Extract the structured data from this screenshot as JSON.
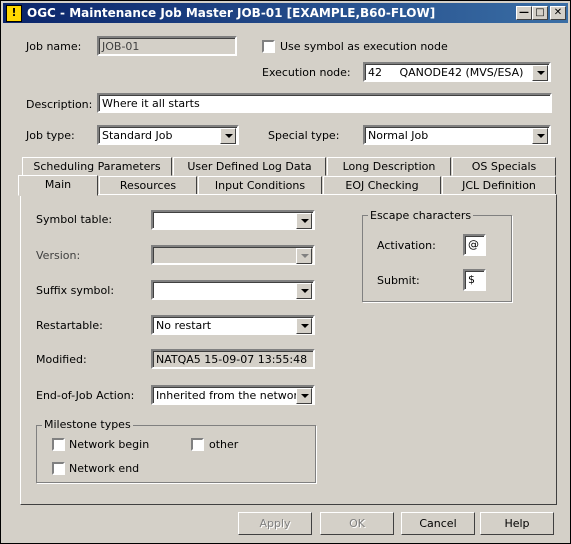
{
  "window": {
    "title": "OGC - Maintenance Job Master JOB-01 [EXAMPLE,B60-FLOW]",
    "icon": "!"
  },
  "header": {
    "job_name_label": "Job name:",
    "job_name_value": "JOB-01",
    "use_symbol_label": "Use symbol as execution node",
    "use_symbol_checked": false,
    "execution_node_label": "Execution node:",
    "execution_node_value": "42     QANODE42 (MVS/ESA)",
    "description_label": "Description:",
    "description_value": "Where it all starts",
    "job_type_label": "Job type:",
    "job_type_value": "Standard Job",
    "special_type_label": "Special type:",
    "special_type_value": "Normal Job"
  },
  "tabs_row1": [
    "Scheduling Parameters",
    "User Defined Log Data",
    "Long Description",
    "OS Specials"
  ],
  "tabs_row2": [
    "Main",
    "Resources",
    "Input Conditions",
    "EOJ Checking",
    "JCL Definition"
  ],
  "active_tab": "Main",
  "main": {
    "symbol_table_label": "Symbol table:",
    "symbol_table_value": "",
    "version_label": "Version:",
    "version_value": "",
    "suffix_symbol_label": "Suffix symbol:",
    "suffix_symbol_value": "",
    "restartable_label": "Restartable:",
    "restartable_value": "No restart",
    "modified_label": "Modified:",
    "modified_value": "NATQA5 15-09-07 13:55:48",
    "eoj_action_label": "End-of-Job Action:",
    "eoj_action_value": "Inherited from the network",
    "milestone": {
      "title": "Milestone types",
      "network_begin": "Network begin",
      "other": "other",
      "network_end": "Network end"
    },
    "escape": {
      "title": "Escape characters",
      "activation_label": "Activation:",
      "activation_value": "@",
      "submit_label": "Submit:",
      "submit_value": "$"
    }
  },
  "buttons": {
    "apply": "Apply",
    "ok": "OK",
    "cancel": "Cancel",
    "help": "Help"
  }
}
